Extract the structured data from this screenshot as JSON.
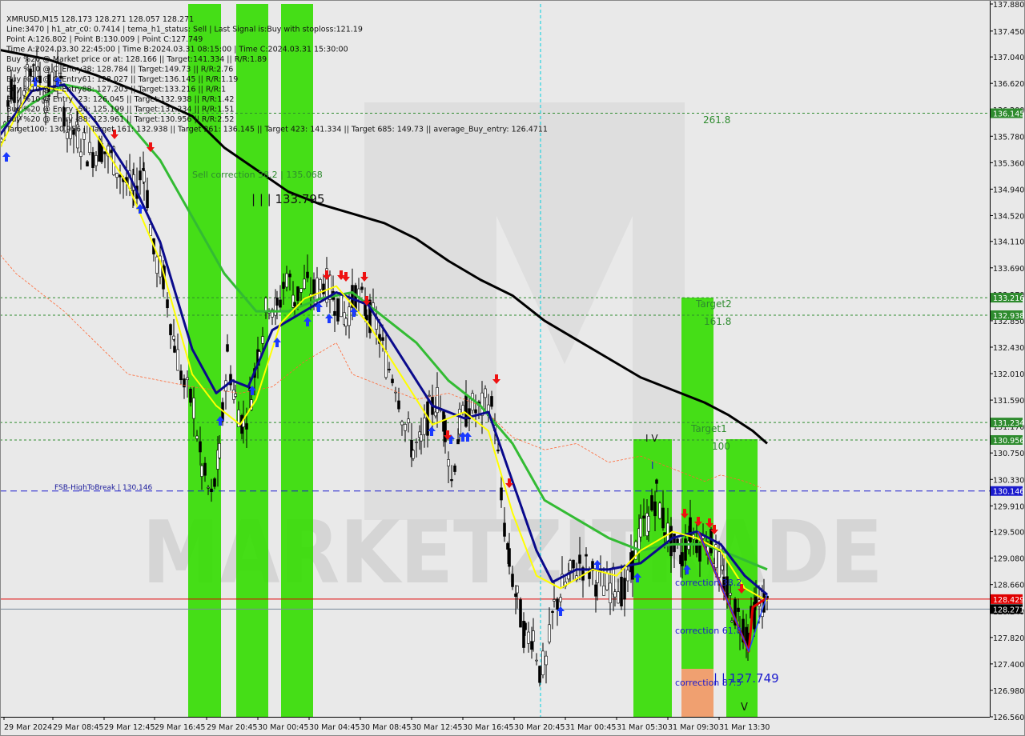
{
  "header": {
    "lines": [
      "XMRUSD,M15  128.173 128.271 128.057 128.271",
      "Line:3470 | h1_atr_c0: 0.7414 | tema_h1_status: Sell | Last Signal is:Buy with stoploss:121.19",
      "Point A:126.802 | Point B:130.009 | Point C:127.749",
      "Time A:2024.03.30 22:45:00 | Time B:2024.03.31 08:15:00 | Time C:2024.03.31 15:30:00",
      "Buy %20 @ Market price or at: 128.166 || Target:141.334 || R/R:1.89",
      "Buy %10 @ C_Entry38: 128.784 || Target:149.73 || R/R:2.76",
      "Buy %10 @ C_Entry61: 128.027 || Target:136.145 || R/R:1.19",
      "Buy %10 @ C_Entry88: 127.203 || Target:133.216 || R/R:1",
      "Buy %10 @ Entry -23: 126.045 || Target:132.938 || R/R:1.42",
      "Buy %20 @ Entry -50: 125.199 || Target:131.234 || R/R:1.51",
      "Buy %20 @ Entry -88: 123.961 || Target:130.956 || R/R:2.52",
      "Target100: 130.956 || Target 161: 132.938 || Target 261: 136.145 || Target 423: 141.334 || Target 685: 149.73 || average_Buy_entry: 126.4711"
    ]
  },
  "watermark": "MARKETZITRADE",
  "chart_data": {
    "type": "candlestick",
    "symbol": "XMRUSD",
    "timeframe": "M15",
    "ylim": [
      126.56,
      137.88
    ],
    "price_ticks": [
      "137.880",
      "137.450",
      "137.040",
      "136.620",
      "136.200",
      "135.780",
      "135.360",
      "134.940",
      "134.520",
      "134.110",
      "133.690",
      "133.270",
      "132.850",
      "132.430",
      "132.010",
      "131.590",
      "131.170",
      "130.750",
      "130.330",
      "129.910",
      "129.500",
      "129.080",
      "128.660",
      "128.240",
      "127.820",
      "127.400",
      "126.980",
      "126.560"
    ],
    "time_ticks": [
      "29 Mar 2024",
      "29 Mar 08:45",
      "29 Mar 12:45",
      "29 Mar 16:45",
      "29 Mar 20:45",
      "30 Mar 00:45",
      "30 Mar 04:45",
      "30 Mar 08:45",
      "30 Mar 12:45",
      "30 Mar 16:45",
      "30 Mar 20:45",
      "31 Mar 00:45",
      "31 Mar 05:30",
      "31 Mar 09:30",
      "31 Mar 13:30"
    ],
    "levels": [
      {
        "price": 136.145,
        "label": "136.145",
        "color": "#2e8b2e",
        "style": "dotted"
      },
      {
        "price": 133.216,
        "label": "133.216",
        "color": "#2e8b2e",
        "style": "dotted"
      },
      {
        "price": 132.938,
        "label": "132.938",
        "color": "#2e8b2e",
        "style": "dotted"
      },
      {
        "price": 131.234,
        "label": "131.234",
        "color": "#2e8b2e",
        "style": "dotted"
      },
      {
        "price": 130.956,
        "label": "130.956",
        "color": "#2e8b2e",
        "style": "dotted"
      },
      {
        "price": 130.146,
        "label": "130.146",
        "color": "#1a1acd",
        "style": "dashed"
      },
      {
        "price": 128.429,
        "label": "128.429",
        "color": "#e00000",
        "style": "solid"
      },
      {
        "price": 128.271,
        "label": "128.271",
        "color": "#7a8a9a",
        "style": "solid"
      }
    ],
    "annotations": [
      {
        "text": "FSB-HighToBreak | 130.146"
      },
      {
        "text": "Sell correction 38.2 | 135.068"
      },
      {
        "text": "| | | 133.795"
      },
      {
        "text": "261.8"
      },
      {
        "text": "Target2"
      },
      {
        "text": "161.8"
      },
      {
        "text": "Target1"
      },
      {
        "text": "100"
      },
      {
        "text": "correction 38.2"
      },
      {
        "text": "correction 61.8"
      },
      {
        "text": "correction 87.5"
      },
      {
        "text": "| | 127.749"
      },
      {
        "text": "I V"
      },
      {
        "text": "I"
      },
      {
        "text": "V"
      }
    ],
    "colors": {
      "background": "#e9e9e9",
      "zone": "#33dd00",
      "zone_orange": "#f0a070",
      "ema_black": "#000000",
      "ema_green": "#33bb33",
      "ema_navy": "#0a0a8c",
      "ema_yellow": "#ffff00",
      "up_arrow": "#1a3aff",
      "down_arrow": "#ee1111"
    }
  }
}
